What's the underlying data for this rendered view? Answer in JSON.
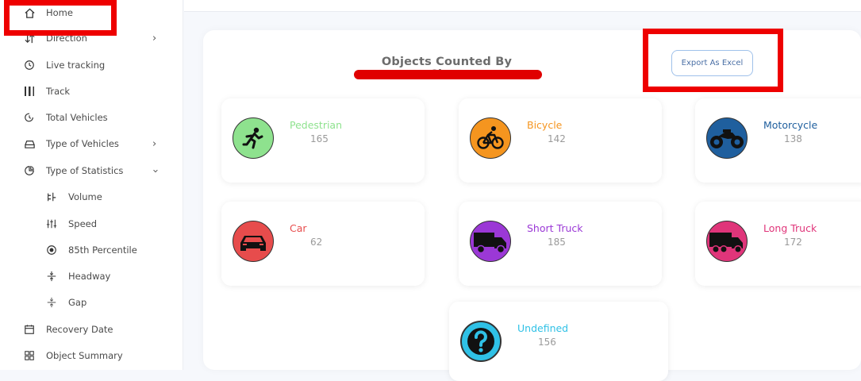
{
  "sidebar": {
    "items": [
      {
        "label": "Home",
        "icon": "home-icon"
      },
      {
        "label": "Direction",
        "icon": "direction-icon"
      },
      {
        "label": "Live tracking",
        "icon": "clock-icon"
      },
      {
        "label": "Track",
        "icon": "track-icon"
      },
      {
        "label": "Total Vehicles",
        "icon": "history-icon"
      },
      {
        "label": "Type of Vehicles",
        "icon": "car-icon"
      },
      {
        "label": "Type of Statistics",
        "icon": "pie-chart-icon"
      },
      {
        "label": "Volume",
        "icon": "volume-icon"
      },
      {
        "label": "Speed",
        "icon": "speed-icon"
      },
      {
        "label": "85th Percentile",
        "icon": "radio-icon"
      },
      {
        "label": "Headway",
        "icon": "headway-icon"
      },
      {
        "label": "Gap",
        "icon": "gap-icon"
      },
      {
        "label": "Recovery Date",
        "icon": "calendar-icon"
      },
      {
        "label": "Object Summary",
        "icon": "grid-icon"
      }
    ]
  },
  "main": {
    "title": "Objects Counted By Class",
    "export_label": "Export As Excel"
  },
  "classes": [
    {
      "name": "Pedestrian",
      "count": "165",
      "color": "#8ee28e"
    },
    {
      "name": "Bicycle",
      "count": "142",
      "color": "#f5951f"
    },
    {
      "name": "Motorcycle",
      "count": "138",
      "color": "#1f5f9e"
    },
    {
      "name": "Car",
      "count": "62",
      "color": "#e74c4c"
    },
    {
      "name": "Short Truck",
      "count": "185",
      "color": "#9b38d6"
    },
    {
      "name": "Long Truck",
      "count": "172",
      "color": "#e0357a"
    },
    {
      "name": "Undefined",
      "count": "156",
      "color": "#2fc1e6"
    }
  ]
}
